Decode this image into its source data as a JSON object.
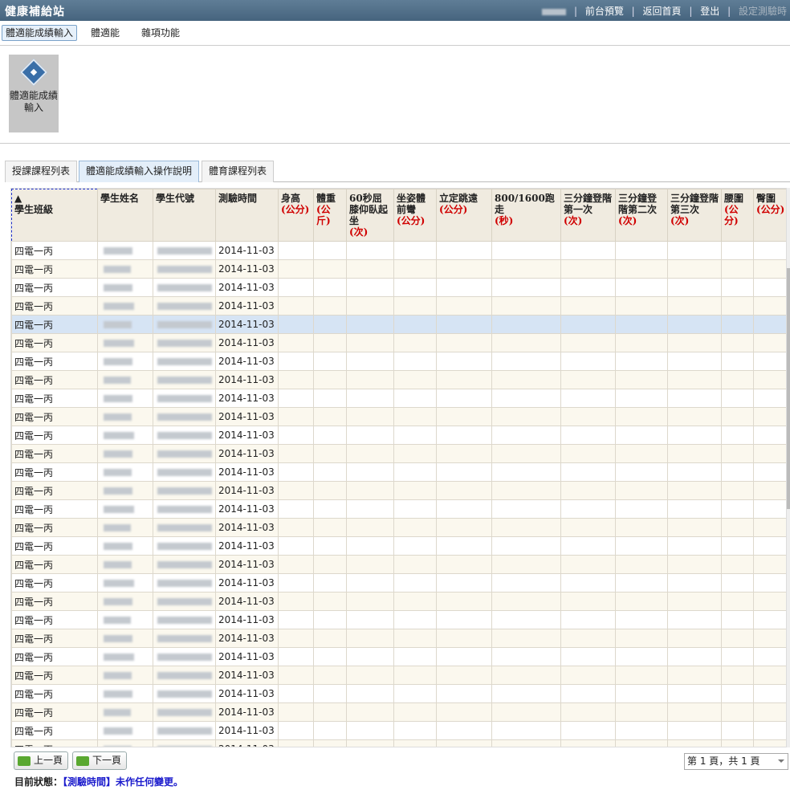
{
  "app": {
    "title": "健康補給站"
  },
  "header": {
    "links": [
      "前台預覽",
      "返回首頁",
      "登出",
      "設定測驗時"
    ]
  },
  "menu": {
    "items": [
      "體適能成績輸入",
      "體適能",
      "雜項功能"
    ]
  },
  "ribbon": {
    "button_label": "體適能成績輸入"
  },
  "tabs": [
    "授課課程列表",
    "體適能成績輸入操作說明",
    "體育課程列表"
  ],
  "table": {
    "sort_indicator": "▲",
    "columns": [
      {
        "label": "學生班級",
        "unit": ""
      },
      {
        "label": "學生姓名",
        "unit": ""
      },
      {
        "label": "學生代號",
        "unit": ""
      },
      {
        "label": "測驗時間",
        "unit": ""
      },
      {
        "label": "身高",
        "unit": "(公分)"
      },
      {
        "label": "體重",
        "unit": "(公斤)"
      },
      {
        "label": "60秒屈膝仰臥起坐",
        "unit": "(次)"
      },
      {
        "label": "坐姿體前彎",
        "unit": "(公分)"
      },
      {
        "label": "立定跳遠",
        "unit": "(公分)"
      },
      {
        "label": "800/1600跑走",
        "unit": "(秒)"
      },
      {
        "label": "三分鐘登階第一次",
        "unit": "(次)"
      },
      {
        "label": "三分鐘登階第二次",
        "unit": "(次)"
      },
      {
        "label": "三分鐘登階第三次",
        "unit": "(次)"
      },
      {
        "label": "腰圍",
        "unit": "(公分)"
      },
      {
        "label": "臀圍",
        "unit": "(公分)"
      }
    ],
    "row_class": "四電一丙",
    "row_date": "2014-11-03",
    "row_count": 28,
    "selected_row": 5
  },
  "pager": {
    "prev": "上一頁",
    "next": "下一頁",
    "page_info": "第 1 頁，共 1 頁"
  },
  "status": {
    "label": "目前狀態：",
    "message": "【測驗時間】未作任何變更。"
  }
}
